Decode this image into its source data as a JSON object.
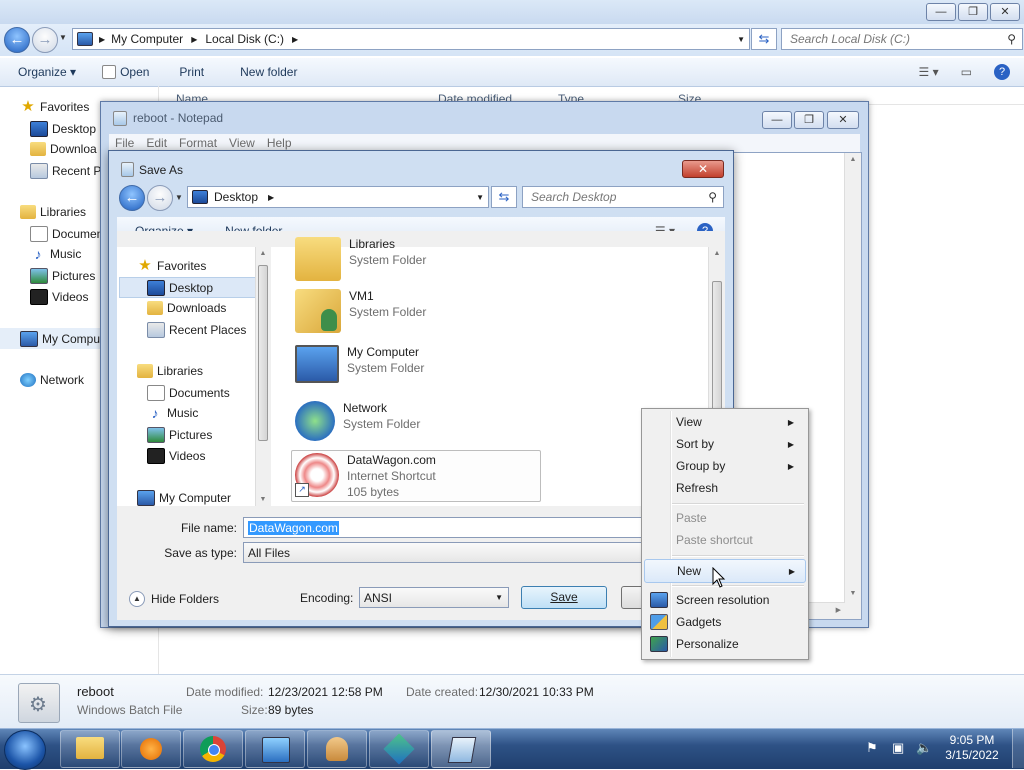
{
  "explorer": {
    "breadcrumb": [
      "My Computer",
      "Local Disk (C:)"
    ],
    "search_placeholder": "Search Local Disk (C:)",
    "toolbar": [
      "Organize",
      "Open",
      "Print",
      "New folder"
    ],
    "columns": [
      "Name",
      "Date modified",
      "Type",
      "Size"
    ],
    "nav": {
      "favorites": "Favorites",
      "desktop": "Desktop",
      "downloads": "Downloa",
      "recent": "Recent Pl",
      "libraries": "Libraries",
      "documents": "Documen",
      "music": "Music",
      "pictures": "Pictures",
      "videos": "Videos",
      "computer": "My Compu",
      "network": "Network"
    }
  },
  "notepad": {
    "title": "reboot - Notepad",
    "menu": [
      "File",
      "Edit",
      "Format",
      "View",
      "Help"
    ]
  },
  "saveas": {
    "title": "Save As",
    "location": "Desktop",
    "search_placeholder": "Search Desktop",
    "organize": "Organize",
    "new_folder": "New folder",
    "nav": {
      "favorites": "Favorites",
      "desktop": "Desktop",
      "downloads": "Downloads",
      "recent": "Recent Places",
      "libraries": "Libraries",
      "documents": "Documents",
      "music": "Music",
      "pictures": "Pictures",
      "videos": "Videos",
      "computer": "My Computer"
    },
    "files": [
      {
        "name": "Libraries",
        "type": "System Folder"
      },
      {
        "name": "VM1",
        "type": "System Folder"
      },
      {
        "name": "My Computer",
        "type": "System Folder"
      },
      {
        "name": "Network",
        "type": "System Folder"
      },
      {
        "name": "DataWagon.com",
        "type": "Internet Shortcut",
        "size": "105 bytes"
      }
    ],
    "file_name_label": "File name:",
    "file_name_value": "DataWagon.com",
    "save_type_label": "Save as type:",
    "save_type_value": "All Files",
    "hide_folders": "Hide Folders",
    "encoding_label": "Encoding:",
    "encoding_value": "ANSI",
    "save_button": "Save"
  },
  "context_menu": {
    "items": [
      "View",
      "Sort by",
      "Group by",
      "Refresh",
      "Paste",
      "Paste shortcut",
      "New",
      "Screen resolution",
      "Gadgets",
      "Personalize"
    ]
  },
  "details": {
    "name": "reboot",
    "type": "Windows Batch File",
    "date_modified_label": "Date modified:",
    "date_modified": "12/23/2021 12:58 PM",
    "date_created_label": "Date created:",
    "date_created": "12/30/2021 10:33 PM",
    "size_label": "Size:",
    "size": "89 bytes"
  },
  "taskbar": {
    "time": "9:05 PM",
    "date": "3/15/2022"
  }
}
